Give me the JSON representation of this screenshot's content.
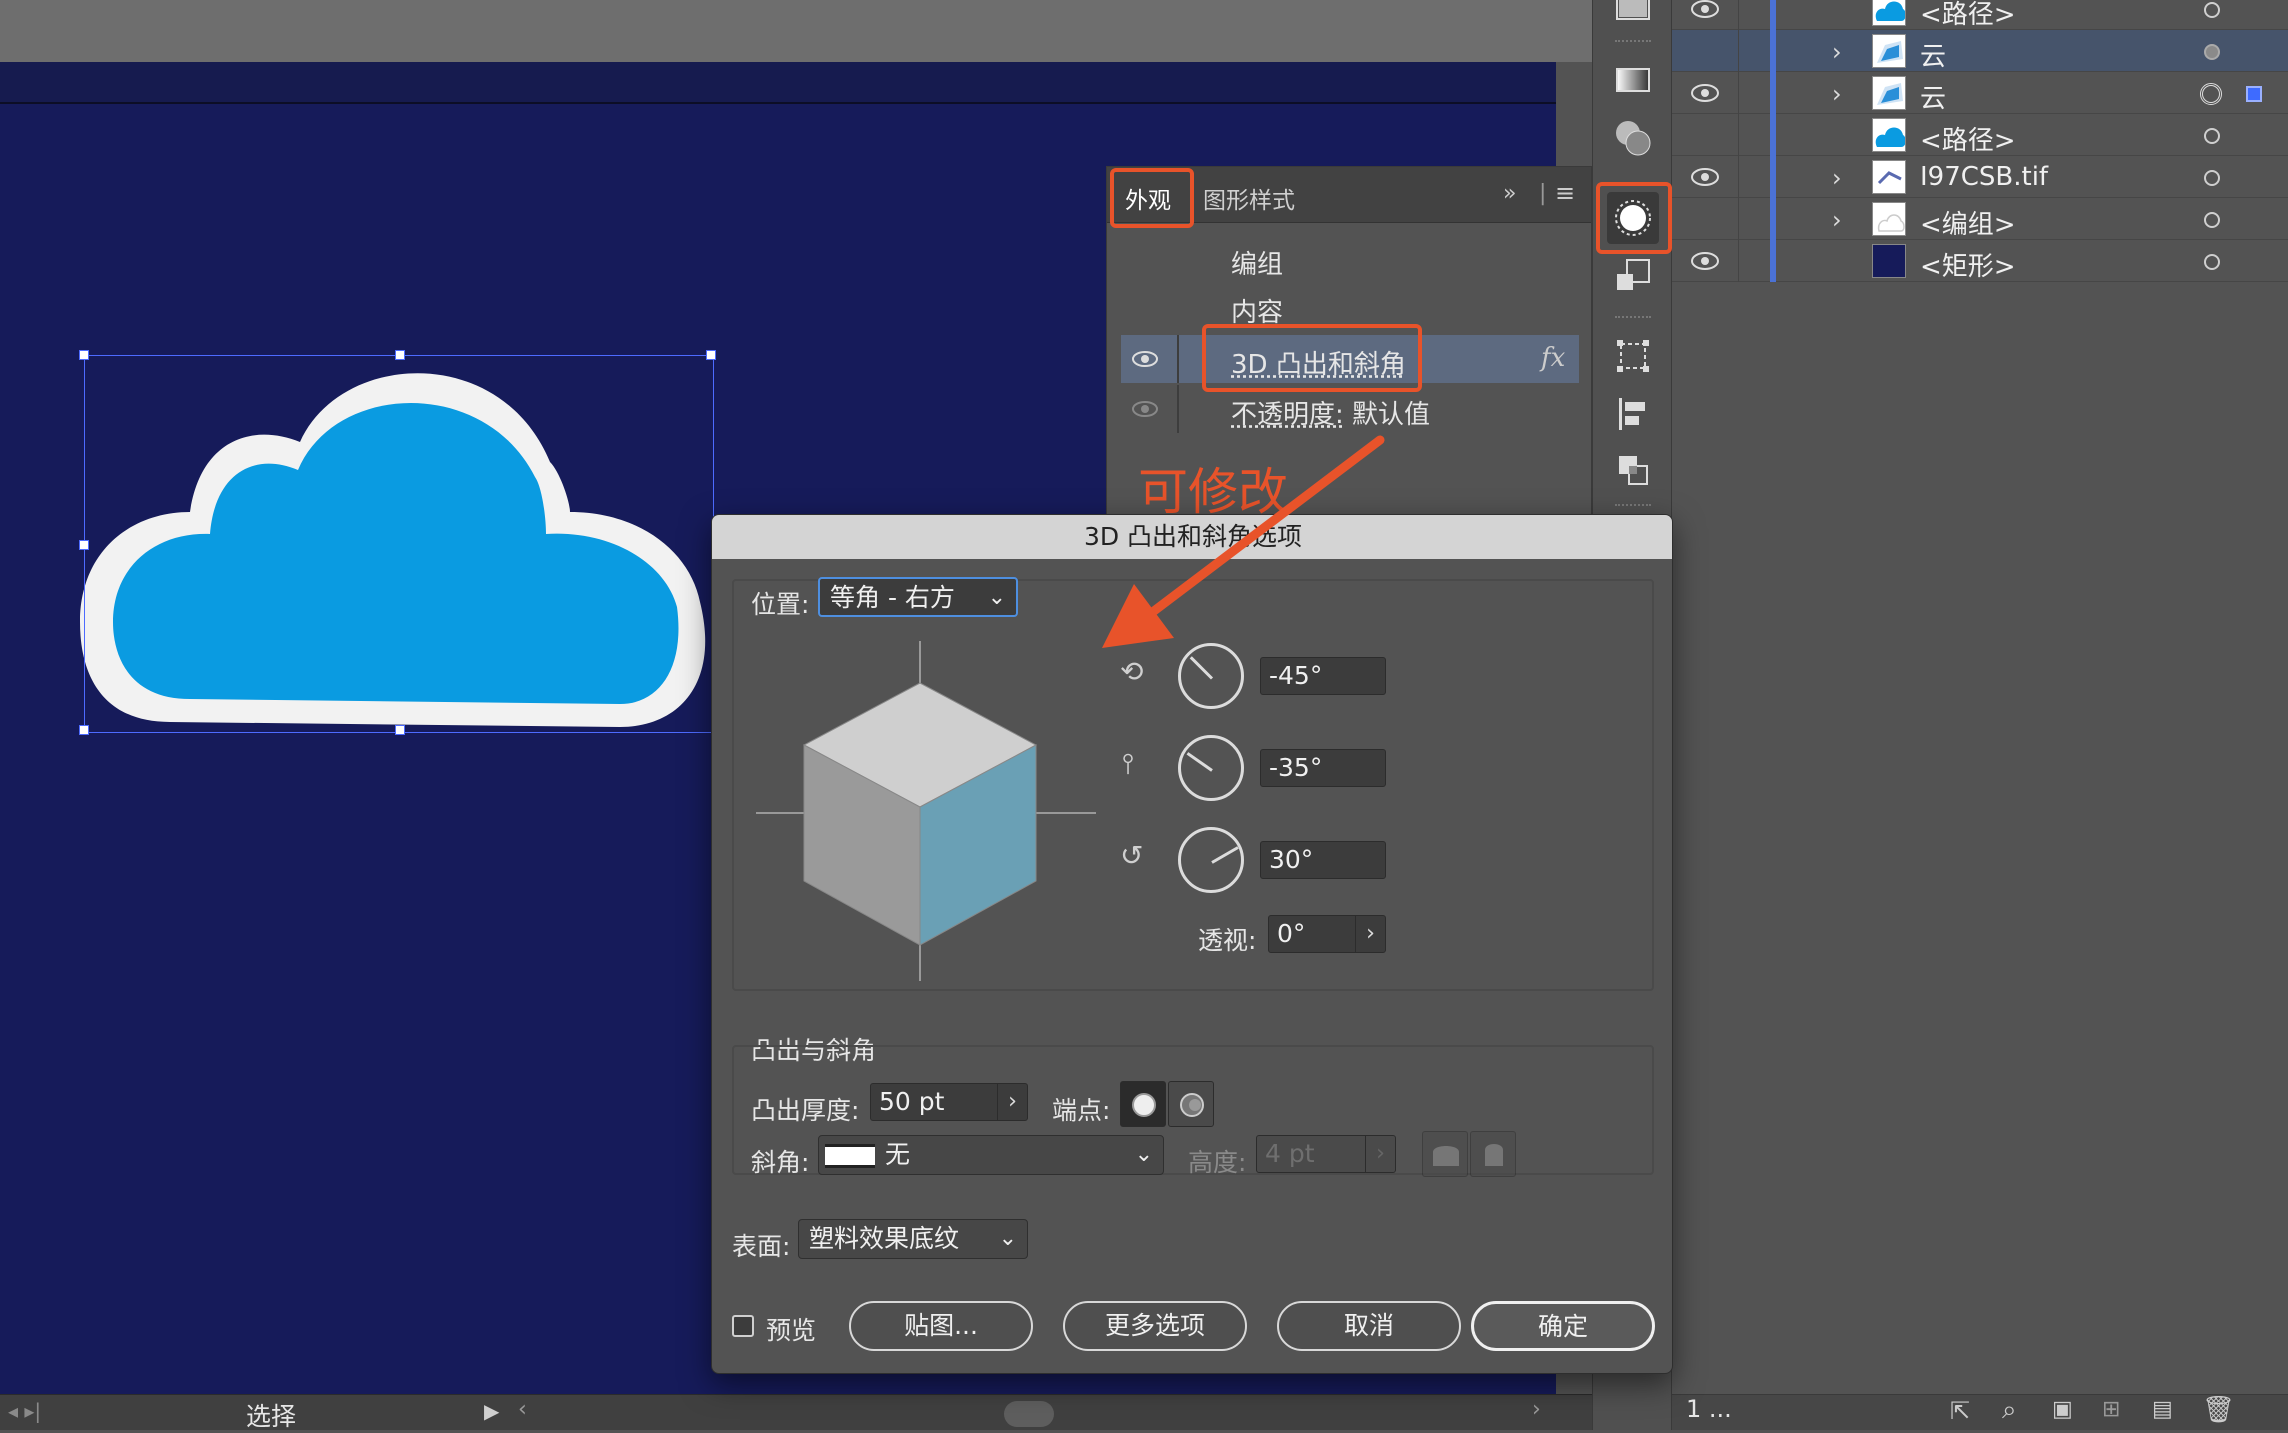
{
  "canvas": {
    "artboard_color": "#161b5a",
    "status_label": "选择"
  },
  "layers": {
    "rows": [
      {
        "name": "<路径>",
        "eye": true,
        "chevron": false,
        "selected": false,
        "thumb": "cloud"
      },
      {
        "name": "云",
        "eye": false,
        "chevron": true,
        "selected": true,
        "thumb": "cloud3d"
      },
      {
        "name": "云",
        "eye": true,
        "chevron": true,
        "selected": false,
        "thumb": "cloud3d"
      },
      {
        "name": "<路径>",
        "eye": false,
        "chevron": false,
        "selected": false,
        "thumb": "cloud"
      },
      {
        "name": "I97CSB.tif",
        "eye": true,
        "chevron": true,
        "selected": false,
        "thumb": "image"
      },
      {
        "name": "<编组>",
        "eye": false,
        "chevron": true,
        "selected": false,
        "thumb": "group"
      },
      {
        "name": "<矩形>",
        "eye": true,
        "chevron": false,
        "selected": false,
        "thumb": "rect"
      }
    ],
    "footer_count": "1 ..."
  },
  "appearance": {
    "tab_active": "外观",
    "tab_other": "图形样式",
    "rows": {
      "group": "编组",
      "content": "内容",
      "effect": "3D 凸出和斜角",
      "fx": "fx",
      "opacity_label": "不透明度:",
      "opacity_value": "默认值"
    }
  },
  "annotation": {
    "text": "可修改",
    "color": "#e8532a"
  },
  "dialog": {
    "title": "3D 凸出和斜角选项",
    "position_label": "位置:",
    "position_value": "等角 - 右方",
    "rot_x": "-45°",
    "rot_y": "-35°",
    "rot_z": "30°",
    "perspective_label": "透视:",
    "perspective_value": "0°",
    "extrude_section": "凸出与斜角",
    "depth_label": "凸出厚度:",
    "depth_value": "50 pt",
    "cap_label": "端点:",
    "bevel_label": "斜角:",
    "bevel_value": "无",
    "height_label": "高度:",
    "height_value": "4 pt",
    "surface_label": "表面:",
    "surface_value": "塑料效果底纹",
    "preview_label": "预览",
    "buttons": {
      "map": "贴图...",
      "more": "更多选项",
      "cancel": "取消",
      "ok": "确定"
    }
  }
}
